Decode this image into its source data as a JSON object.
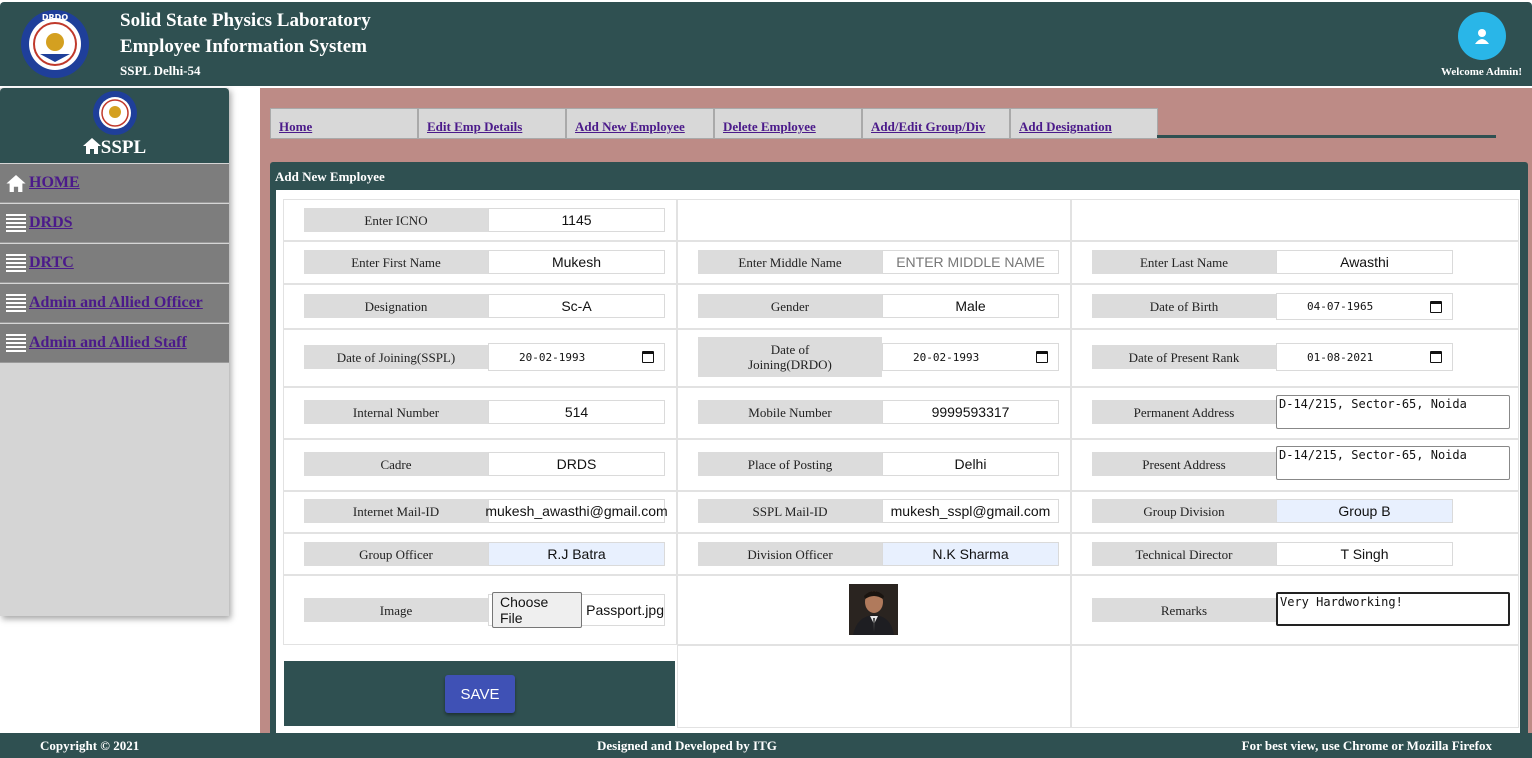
{
  "header": {
    "title_line1": "Solid State Physics Laboratory",
    "title_line2": "Employee Information System",
    "subtitle": "SSPL Delhi-54",
    "welcome": "Welcome Admin!",
    "logo_text": "DRDO"
  },
  "sidebar": {
    "title": "SSPL",
    "items": [
      {
        "label": "HOME",
        "icon": "home-icon"
      },
      {
        "label": "DRDS",
        "icon": "list-icon"
      },
      {
        "label": "DRTC",
        "icon": "list-icon"
      },
      {
        "label": "Admin and Allied Officer",
        "icon": "list-icon"
      },
      {
        "label": "Admin and Allied Staff",
        "icon": "list-icon"
      }
    ]
  },
  "tabs": [
    "Home",
    "Edit Emp Details",
    "Add New Employee",
    "Delete Employee",
    "Add/Edit Group/Div",
    "Add Designation"
  ],
  "form": {
    "title": "Add New Employee",
    "icno": {
      "label": "Enter ICNO",
      "value": "1145"
    },
    "first_name": {
      "label": "Enter First Name",
      "value": "Mukesh"
    },
    "middle_name": {
      "label": "Enter Middle Name",
      "placeholder": "ENTER MIDDLE NAME"
    },
    "last_name": {
      "label": "Enter Last Name",
      "value": "Awasthi"
    },
    "designation": {
      "label": "Designation",
      "value": "Sc-A"
    },
    "gender": {
      "label": "Gender",
      "value": "Male"
    },
    "dob": {
      "label": "Date of Birth",
      "value": "04-07-1965"
    },
    "doj_sspl": {
      "label": "Date of Joining(SSPL)",
      "value": "20-02-1993"
    },
    "doj_drdo": {
      "label": "Date of Joining(DRDO)",
      "value": "20-02-1993"
    },
    "present_rank": {
      "label": "Date of Present Rank",
      "value": "01-08-2021"
    },
    "internal_number": {
      "label": "Internal Number",
      "value": "514"
    },
    "mobile": {
      "label": "Mobile Number",
      "value": "9999593317"
    },
    "permanent_address": {
      "label": "Permanent Address",
      "value": "D-14/215, Sector-65, Noida"
    },
    "cadre": {
      "label": "Cadre",
      "value": "DRDS"
    },
    "posting": {
      "label": "Place of Posting",
      "value": "Delhi"
    },
    "present_address": {
      "label": "Present Address",
      "value": "D-14/215, Sector-65, Noida"
    },
    "internet_mail": {
      "label": "Internet Mail-ID",
      "value": "mukesh_awasthi@gmail.com"
    },
    "sspl_mail": {
      "label": "SSPL Mail-ID",
      "value": "mukesh_sspl@gmail.com"
    },
    "group_division": {
      "label": "Group Division",
      "value": "Group B"
    },
    "group_officer": {
      "label": "Group Officer",
      "value": "R.J Batra"
    },
    "division_officer": {
      "label": "Division Officer",
      "value": "N.K Sharma"
    },
    "technical_director": {
      "label": "Technical Director",
      "value": "T Singh"
    },
    "image": {
      "label": "Image",
      "button": "Choose File",
      "file": "Passport.jpg"
    },
    "remarks": {
      "label": "Remarks",
      "value": "Very Hardworking!"
    },
    "save": "SAVE"
  },
  "footer": {
    "copyright": "Copyright © 2021",
    "designed": "Designed and Developed by ITG",
    "best_view": "For best view, use Chrome or Mozilla Firefox"
  },
  "colors": {
    "primary": "#2f5051",
    "frame": "#bd8b86",
    "accent": "#3f51b5",
    "avatar": "#29b6e8"
  }
}
